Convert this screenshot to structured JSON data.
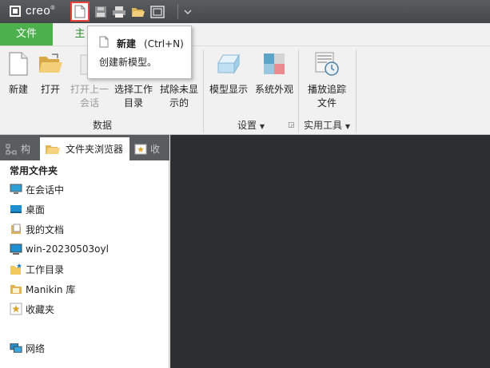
{
  "title_bar": {
    "logo_text": "creo",
    "logo_mark": "®",
    "quick_access": [
      "new-icon",
      "save-icon",
      "print-icon",
      "open-icon",
      "windows-icon",
      "dropdown-icon"
    ]
  },
  "tabs": {
    "file": "文件",
    "home": "主"
  },
  "tooltip": {
    "title": "新建",
    "shortcut": "(Ctrl+N)",
    "description": "创建新模型。"
  },
  "ribbon": {
    "buttons": {
      "new": "新建",
      "open": "打开",
      "open_last": "打开上一\n会话",
      "select_dir": "选择工作\n目录",
      "erase": "拭除未显\n示的",
      "model_display": "模型显示",
      "appearance": "系统外观",
      "playback": "播放追踪\n文件"
    },
    "groups": {
      "data": "数据",
      "settings": "设置",
      "utilities": "实用工具"
    }
  },
  "left_panel": {
    "tabs": {
      "model_tree": "构",
      "folder_browser": "文件夹浏览器",
      "favorites": "收"
    },
    "section_title": "常用文件夹",
    "items": [
      {
        "label": "在会话中",
        "icon": "monitor-icon"
      },
      {
        "label": "桌面",
        "icon": "desktop-icon"
      },
      {
        "label": "我的文档",
        "icon": "documents-icon"
      },
      {
        "label": "win-20230503oyl",
        "icon": "computer-icon"
      },
      {
        "label": "工作目录",
        "icon": "working-dir-icon"
      },
      {
        "label": "Manikin 库",
        "icon": "library-icon"
      },
      {
        "label": "收藏夹",
        "icon": "favorites-icon"
      }
    ],
    "network": {
      "label": "网络",
      "icon": "network-icon"
    }
  },
  "colors": {
    "titlebar": "#4b4e51",
    "file_tab": "#4cb04c",
    "highlight_border": "#e8453c",
    "graphics_area": "#2b2f32"
  }
}
